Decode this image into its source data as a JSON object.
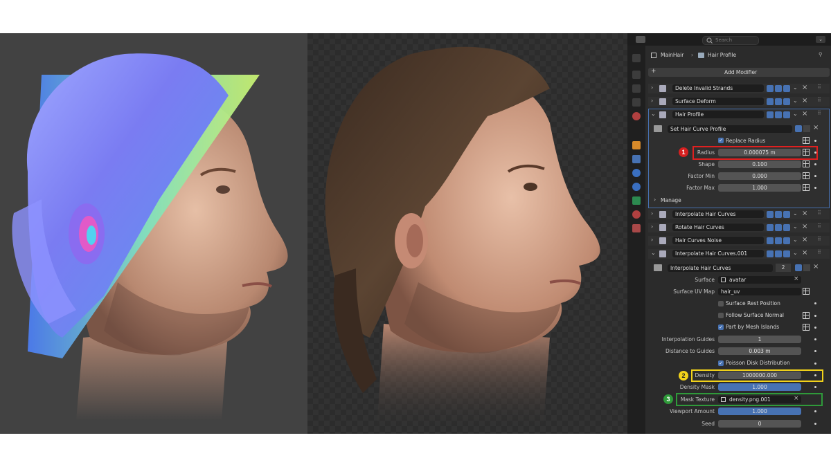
{
  "search": {
    "placeholder": "Search"
  },
  "breadcrumb": {
    "object": "MainHair",
    "modifier": "Hair Profile"
  },
  "add_modifier_label": "Add Modifier",
  "modifiers": [
    {
      "name": "Delete Invalid Strands"
    },
    {
      "name": "Surface Deform"
    },
    {
      "name": "Hair Profile"
    }
  ],
  "hair_profile": {
    "node_group": "Set Hair Curve Profile",
    "replace_radius": {
      "label": "Replace Radius"
    },
    "radius": {
      "label": "Radius",
      "value": "0.000075 m"
    },
    "shape": {
      "label": "Shape",
      "value": "0.100"
    },
    "factor_min": {
      "label": "Factor Min",
      "value": "0.000"
    },
    "factor_max": {
      "label": "Factor Max",
      "value": "1.000"
    },
    "manage_label": "Manage"
  },
  "modifiers2": [
    {
      "name": "Interpolate Hair Curves"
    },
    {
      "name": "Rotate Hair Curves"
    },
    {
      "name": "Hair Curves Noise"
    },
    {
      "name": "Interpolate Hair Curves.001"
    }
  ],
  "interp": {
    "node_group": "Interpolate Hair Curves",
    "users": "2",
    "surface": {
      "label": "Surface",
      "value": "avatar"
    },
    "surface_uv": {
      "label": "Surface UV Map",
      "value": "hair_uv"
    },
    "surface_rest": {
      "label": "Surface Rest Position"
    },
    "follow_normal": {
      "label": "Follow Surface Normal"
    },
    "part_mesh": {
      "label": "Part by Mesh Islands"
    },
    "interp_guides": {
      "label": "Interpolation Guides",
      "value": "1"
    },
    "dist_guides": {
      "label": "Distance to Guides",
      "value": "0.003 m"
    },
    "poisson": {
      "label": "Poisson Disk Distribution"
    },
    "density": {
      "label": "Density",
      "value": "1000000.000"
    },
    "density_mask": {
      "label": "Density Mask",
      "value": "1.000"
    },
    "mask_texture": {
      "label": "Mask Texture",
      "value": "density.png.001"
    },
    "viewport_amount": {
      "label": "Viewport Amount",
      "value": "1.000"
    },
    "seed": {
      "label": "Seed",
      "value": "0"
    }
  },
  "annotations": {
    "badge1": "1",
    "badge2": "2",
    "badge3": "3"
  },
  "colors": {
    "accent": "#4772b3",
    "red": "#e02020",
    "yellow": "#f2d21a",
    "green": "#2f9a3a"
  }
}
